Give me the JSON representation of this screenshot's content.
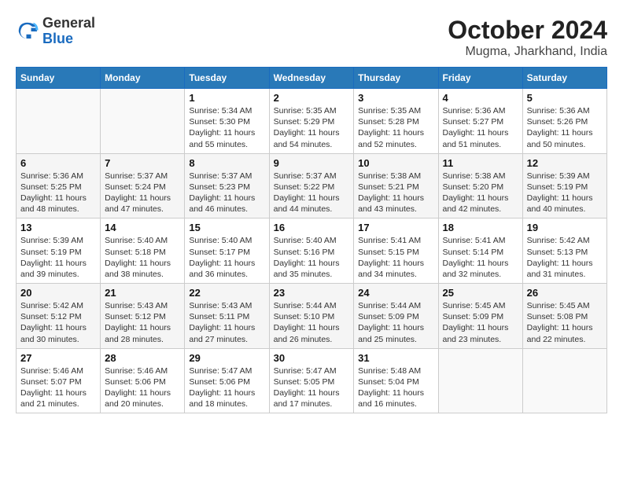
{
  "header": {
    "logo_general": "General",
    "logo_blue": "Blue",
    "title": "October 2024",
    "subtitle": "Mugma, Jharkhand, India"
  },
  "calendar": {
    "days_of_week": [
      "Sunday",
      "Monday",
      "Tuesday",
      "Wednesday",
      "Thursday",
      "Friday",
      "Saturday"
    ],
    "weeks": [
      [
        {
          "day": "",
          "info": ""
        },
        {
          "day": "",
          "info": ""
        },
        {
          "day": "1",
          "info": "Sunrise: 5:34 AM\nSunset: 5:30 PM\nDaylight: 11 hours and 55 minutes."
        },
        {
          "day": "2",
          "info": "Sunrise: 5:35 AM\nSunset: 5:29 PM\nDaylight: 11 hours and 54 minutes."
        },
        {
          "day": "3",
          "info": "Sunrise: 5:35 AM\nSunset: 5:28 PM\nDaylight: 11 hours and 52 minutes."
        },
        {
          "day": "4",
          "info": "Sunrise: 5:36 AM\nSunset: 5:27 PM\nDaylight: 11 hours and 51 minutes."
        },
        {
          "day": "5",
          "info": "Sunrise: 5:36 AM\nSunset: 5:26 PM\nDaylight: 11 hours and 50 minutes."
        }
      ],
      [
        {
          "day": "6",
          "info": "Sunrise: 5:36 AM\nSunset: 5:25 PM\nDaylight: 11 hours and 48 minutes."
        },
        {
          "day": "7",
          "info": "Sunrise: 5:37 AM\nSunset: 5:24 PM\nDaylight: 11 hours and 47 minutes."
        },
        {
          "day": "8",
          "info": "Sunrise: 5:37 AM\nSunset: 5:23 PM\nDaylight: 11 hours and 46 minutes."
        },
        {
          "day": "9",
          "info": "Sunrise: 5:37 AM\nSunset: 5:22 PM\nDaylight: 11 hours and 44 minutes."
        },
        {
          "day": "10",
          "info": "Sunrise: 5:38 AM\nSunset: 5:21 PM\nDaylight: 11 hours and 43 minutes."
        },
        {
          "day": "11",
          "info": "Sunrise: 5:38 AM\nSunset: 5:20 PM\nDaylight: 11 hours and 42 minutes."
        },
        {
          "day": "12",
          "info": "Sunrise: 5:39 AM\nSunset: 5:19 PM\nDaylight: 11 hours and 40 minutes."
        }
      ],
      [
        {
          "day": "13",
          "info": "Sunrise: 5:39 AM\nSunset: 5:19 PM\nDaylight: 11 hours and 39 minutes."
        },
        {
          "day": "14",
          "info": "Sunrise: 5:40 AM\nSunset: 5:18 PM\nDaylight: 11 hours and 38 minutes."
        },
        {
          "day": "15",
          "info": "Sunrise: 5:40 AM\nSunset: 5:17 PM\nDaylight: 11 hours and 36 minutes."
        },
        {
          "day": "16",
          "info": "Sunrise: 5:40 AM\nSunset: 5:16 PM\nDaylight: 11 hours and 35 minutes."
        },
        {
          "day": "17",
          "info": "Sunrise: 5:41 AM\nSunset: 5:15 PM\nDaylight: 11 hours and 34 minutes."
        },
        {
          "day": "18",
          "info": "Sunrise: 5:41 AM\nSunset: 5:14 PM\nDaylight: 11 hours and 32 minutes."
        },
        {
          "day": "19",
          "info": "Sunrise: 5:42 AM\nSunset: 5:13 PM\nDaylight: 11 hours and 31 minutes."
        }
      ],
      [
        {
          "day": "20",
          "info": "Sunrise: 5:42 AM\nSunset: 5:12 PM\nDaylight: 11 hours and 30 minutes."
        },
        {
          "day": "21",
          "info": "Sunrise: 5:43 AM\nSunset: 5:12 PM\nDaylight: 11 hours and 28 minutes."
        },
        {
          "day": "22",
          "info": "Sunrise: 5:43 AM\nSunset: 5:11 PM\nDaylight: 11 hours and 27 minutes."
        },
        {
          "day": "23",
          "info": "Sunrise: 5:44 AM\nSunset: 5:10 PM\nDaylight: 11 hours and 26 minutes."
        },
        {
          "day": "24",
          "info": "Sunrise: 5:44 AM\nSunset: 5:09 PM\nDaylight: 11 hours and 25 minutes."
        },
        {
          "day": "25",
          "info": "Sunrise: 5:45 AM\nSunset: 5:09 PM\nDaylight: 11 hours and 23 minutes."
        },
        {
          "day": "26",
          "info": "Sunrise: 5:45 AM\nSunset: 5:08 PM\nDaylight: 11 hours and 22 minutes."
        }
      ],
      [
        {
          "day": "27",
          "info": "Sunrise: 5:46 AM\nSunset: 5:07 PM\nDaylight: 11 hours and 21 minutes."
        },
        {
          "day": "28",
          "info": "Sunrise: 5:46 AM\nSunset: 5:06 PM\nDaylight: 11 hours and 20 minutes."
        },
        {
          "day": "29",
          "info": "Sunrise: 5:47 AM\nSunset: 5:06 PM\nDaylight: 11 hours and 18 minutes."
        },
        {
          "day": "30",
          "info": "Sunrise: 5:47 AM\nSunset: 5:05 PM\nDaylight: 11 hours and 17 minutes."
        },
        {
          "day": "31",
          "info": "Sunrise: 5:48 AM\nSunset: 5:04 PM\nDaylight: 11 hours and 16 minutes."
        },
        {
          "day": "",
          "info": ""
        },
        {
          "day": "",
          "info": ""
        }
      ]
    ]
  }
}
